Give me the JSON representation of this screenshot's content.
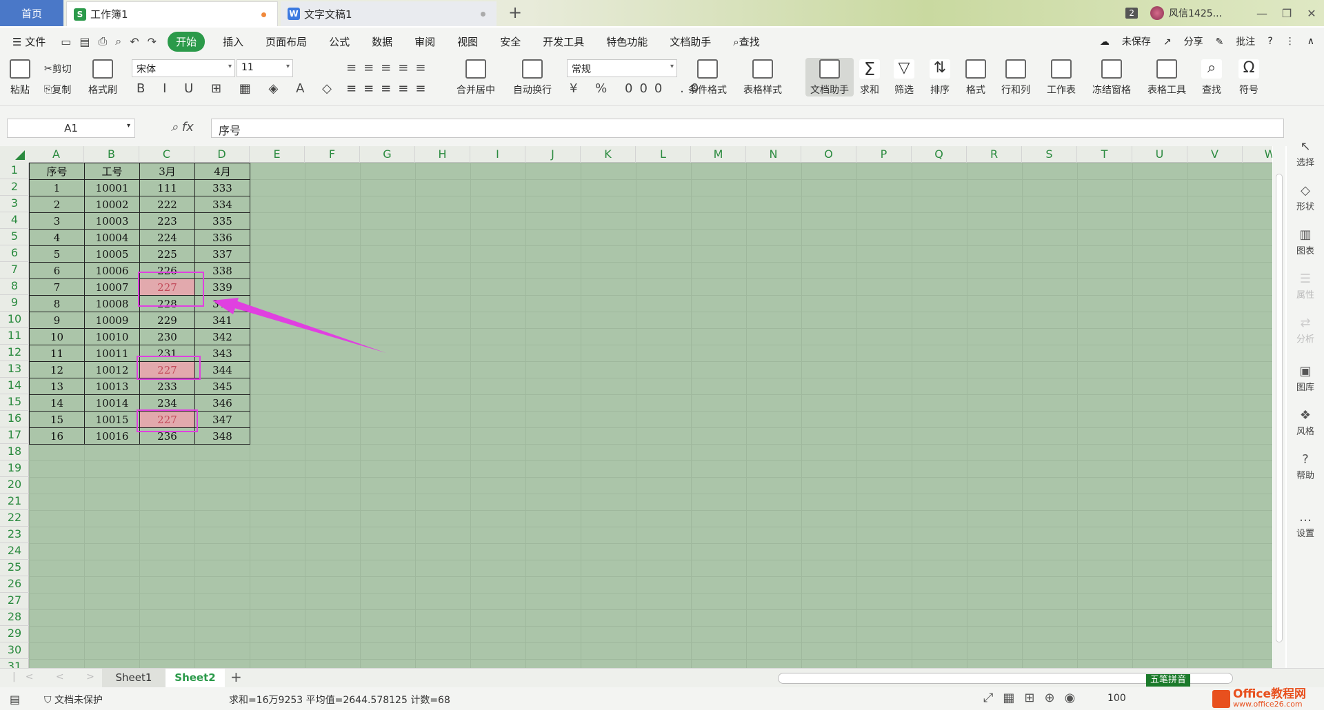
{
  "tabs": {
    "home": "首页",
    "workbook": "工作簿1",
    "doc": "文字文稿1",
    "badge": "2",
    "user": "风信1425...",
    "min": "—",
    "max": "❐",
    "close": "✕"
  },
  "menu": {
    "items": [
      "文件",
      "开始",
      "插入",
      "页面布局",
      "公式",
      "数据",
      "审阅",
      "视图",
      "安全",
      "开发工具",
      "特色功能",
      "文档助手",
      "查找"
    ],
    "unsaved": "未保存",
    "share": "分享",
    "comment": "批注",
    "help": "?"
  },
  "ribbon": {
    "paste": "粘贴",
    "cut": "剪切",
    "copy": "复制",
    "format_painter": "格式刷",
    "font": "宋体",
    "size": "11",
    "merge": "合并居中",
    "wrap": "自动换行",
    "numfmt": "常规",
    "cond": "条件格式",
    "tablestyle": "表格样式",
    "assistant": "文档助手",
    "sum": "求和",
    "filter": "筛选",
    "sort": "排序",
    "format": "格式",
    "rowcol": "行和列",
    "sheet": "工作表",
    "freeze": "冻结窗格",
    "tabletools": "表格工具",
    "find": "查找",
    "symbol": "符号"
  },
  "formula": {
    "cell": "A1",
    "content": "序号"
  },
  "columns": [
    "A",
    "B",
    "C",
    "D",
    "E",
    "F",
    "G",
    "H",
    "I",
    "J",
    "K",
    "L",
    "M",
    "N",
    "O",
    "P",
    "Q",
    "R",
    "S",
    "T",
    "U",
    "V",
    "W"
  ],
  "rows": [
    "1",
    "2",
    "3",
    "4",
    "5",
    "6",
    "7",
    "8",
    "9",
    "10",
    "11",
    "12",
    "13",
    "14",
    "15",
    "16",
    "17",
    "18",
    "19",
    "20",
    "21",
    "22",
    "23",
    "24",
    "25",
    "26",
    "27",
    "28",
    "29",
    "30",
    "31"
  ],
  "table": {
    "header": [
      "序号",
      "工号",
      "3月",
      "4月"
    ],
    "rows": [
      [
        "1",
        "10001",
        "111",
        "333"
      ],
      [
        "2",
        "10002",
        "222",
        "334"
      ],
      [
        "3",
        "10003",
        "223",
        "335"
      ],
      [
        "4",
        "10004",
        "224",
        "336"
      ],
      [
        "5",
        "10005",
        "225",
        "337"
      ],
      [
        "6",
        "10006",
        "226",
        "338"
      ],
      [
        "7",
        "10007",
        "227",
        "339"
      ],
      [
        "8",
        "10008",
        "228",
        "340"
      ],
      [
        "9",
        "10009",
        "229",
        "341"
      ],
      [
        "10",
        "10010",
        "230",
        "342"
      ],
      [
        "11",
        "10011",
        "231",
        "343"
      ],
      [
        "12",
        "10012",
        "227",
        "344"
      ],
      [
        "13",
        "10013",
        "233",
        "345"
      ],
      [
        "14",
        "10014",
        "234",
        "346"
      ],
      [
        "15",
        "10015",
        "227",
        "347"
      ],
      [
        "16",
        "10016",
        "236",
        "348"
      ]
    ],
    "highlight_rows": [
      6,
      11,
      14
    ],
    "highlight_color": "#e2a9ad"
  },
  "sidebar": [
    "选择",
    "形状",
    "图表",
    "属性",
    "分析",
    "图库",
    "风格",
    "帮助",
    "设置"
  ],
  "sheets": [
    "Sheet1",
    "Sheet2"
  ],
  "ime": "五笔拼音",
  "status": {
    "protect": "文档未保护",
    "stats": "求和=16万9253  平均值=2644.578125  计数=68",
    "zoom": "100"
  },
  "logo": {
    "line1": "Office教程网",
    "line2": "www.office26.com"
  },
  "colors": {
    "accent": "#2b9a4a",
    "grid_bg": "#abc5a9",
    "annotation": "#e040e0"
  }
}
